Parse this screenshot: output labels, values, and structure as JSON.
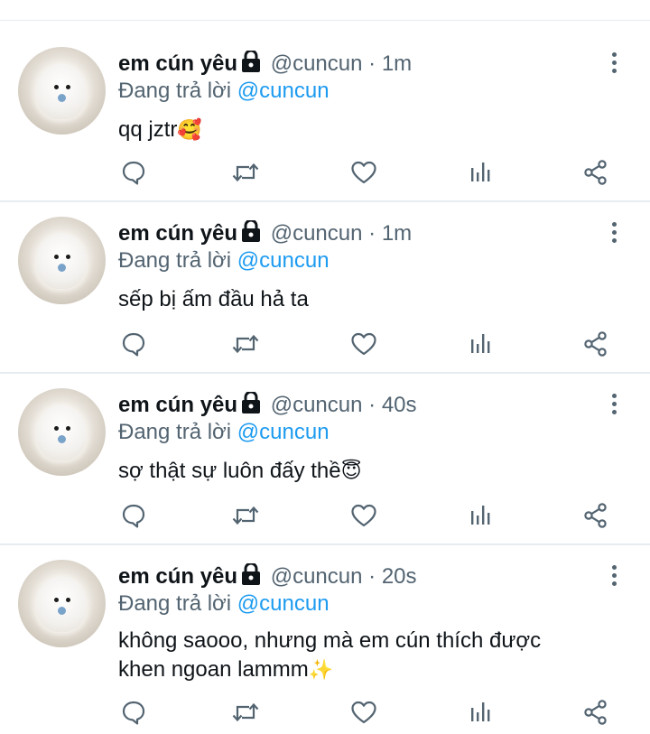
{
  "tweets": [
    {
      "name": "em cún yêu",
      "handle": "@cuncun",
      "sep": " · ",
      "time": "1m",
      "reply_prefix": "Đang trả lời",
      "reply_to": "@cuncun",
      "text": "qq jztr",
      "emoji": "🥰"
    },
    {
      "name": "em cún yêu",
      "handle": "@cuncun",
      "sep": " · ",
      "time": "1m",
      "reply_prefix": "Đang trả lời",
      "reply_to": "@cuncun",
      "text": "sếp bị ấm đầu hả ta",
      "emoji": ""
    },
    {
      "name": "em cún yêu",
      "handle": "@cuncun",
      "sep": " · ",
      "time": "40s",
      "reply_prefix": "Đang trả lời",
      "reply_to": "@cuncun",
      "text": "sợ thật sự luôn đấy thề",
      "emoji": "😇"
    },
    {
      "name": "em cún yêu",
      "handle": "@cuncun",
      "sep": " · ",
      "time": "20s",
      "reply_prefix": "Đang trả lời",
      "reply_to": "@cuncun",
      "text": "không saooo, nhưng mà em cún thích được khen ngoan lammm",
      "emoji": "✨"
    }
  ],
  "icons": {
    "reply": "comment-icon",
    "retweet": "retweet-icon",
    "like": "heart-icon",
    "analytics": "analytics-icon",
    "share": "share-icon",
    "more": "more-vertical-icon",
    "lock": "lock-icon"
  },
  "colors": {
    "text": "#0f1419",
    "secondary": "#536471",
    "accent": "#1d9bf0",
    "divider": "#e6ecf0"
  }
}
